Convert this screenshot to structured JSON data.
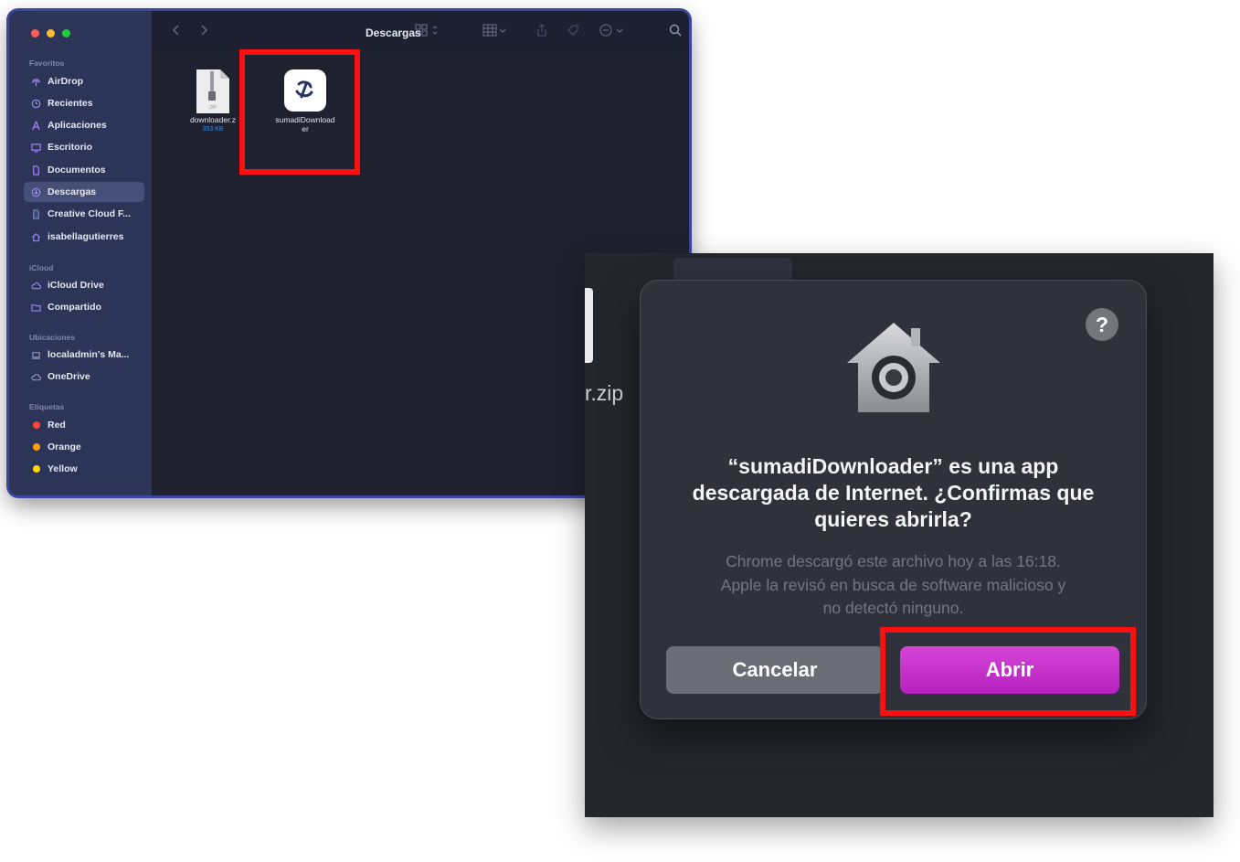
{
  "finder": {
    "title": "Descargas",
    "sidebar": {
      "sections": {
        "favoritos": "Favoritos",
        "icloud": "iCloud",
        "ubicaciones": "Ubicaciones",
        "etiquetas": "Etiquetas"
      },
      "favorites": [
        {
          "label": "AirDrop",
          "icon": "airdrop-icon"
        },
        {
          "label": "Recientes",
          "icon": "clock-icon"
        },
        {
          "label": "Aplicaciones",
          "icon": "applications-icon"
        },
        {
          "label": "Escritorio",
          "icon": "desktop-icon"
        },
        {
          "label": "Documentos",
          "icon": "document-icon"
        },
        {
          "label": "Descargas",
          "icon": "download-icon",
          "selected": true
        },
        {
          "label": "Creative Cloud F...",
          "icon": "document-icon"
        },
        {
          "label": "isabellagutierres",
          "icon": "home-icon"
        }
      ],
      "icloud": [
        {
          "label": "iCloud Drive",
          "icon": "cloud-icon"
        },
        {
          "label": "Compartido",
          "icon": "shared-folder-icon"
        }
      ],
      "locations": [
        {
          "label": "localadmin's Ma...",
          "icon": "laptop-icon"
        },
        {
          "label": "OneDrive",
          "icon": "cloud-icon"
        }
      ],
      "tags": [
        {
          "label": "Red",
          "color": "#ff453a"
        },
        {
          "label": "Orange",
          "color": "#ff9f0a"
        },
        {
          "label": "Yellow",
          "color": "#ffd60a"
        }
      ]
    },
    "files": [
      {
        "name": "downloader.z",
        "meta": "353 KB",
        "icon": "zip-file-icon"
      },
      {
        "name_line1": "sumadiDownload",
        "name_line2": "er",
        "icon": "app-icon"
      }
    ]
  },
  "dialog": {
    "help": "?",
    "title_line1": "“sumadiDownloader” es una app",
    "title_line2": "descargada de Internet. ¿Confirmas que",
    "title_line3": "quieres abrirla?",
    "body_line1": "Chrome descargó este archivo hoy a las 16:18.",
    "body_line2": "Apple la revisó en busca de software malicioso y",
    "body_line3": "no detectó ninguno.",
    "cancel_label": "Cancelar",
    "open_label": "Abrir",
    "accent_color": "#c832cc"
  },
  "background": {
    "partial_filename": "r.zip"
  },
  "highlight_color": "#ff1010"
}
